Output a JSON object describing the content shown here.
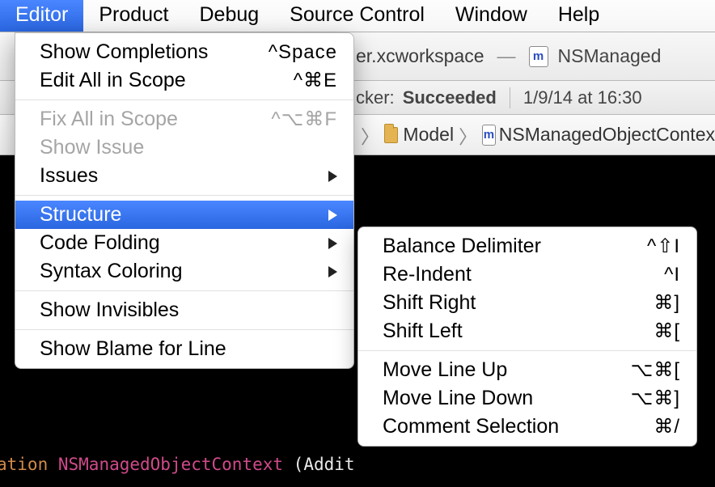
{
  "menubar": {
    "items": [
      "Editor",
      "Product",
      "Debug",
      "Source Control",
      "Window",
      "Help"
    ],
    "active_index": 0
  },
  "toolbar": {
    "workspace_suffix": "er.xcworkspace",
    "dash": "—",
    "open_file": "NSManaged",
    "status_prefix": "cker:",
    "status_value": "Succeeded",
    "timestamp": "1/9/14 at 16:30"
  },
  "breadcrumb": {
    "folder": "Model",
    "file": "NSManagedObjectContex"
  },
  "editor_menu": {
    "items": [
      {
        "label": "Show Completions",
        "shortcut": "^Space",
        "submenu": false,
        "disabled": false
      },
      {
        "label": "Edit All in Scope",
        "shortcut": "^⌘E",
        "submenu": false,
        "disabled": false
      },
      {
        "sep": true
      },
      {
        "label": "Fix All in Scope",
        "shortcut": "^⌥⌘F",
        "submenu": false,
        "disabled": true
      },
      {
        "label": "Show Issue",
        "shortcut": "",
        "submenu": false,
        "disabled": true
      },
      {
        "label": "Issues",
        "shortcut": "",
        "submenu": true,
        "disabled": false
      },
      {
        "sep": true
      },
      {
        "label": "Structure",
        "shortcut": "",
        "submenu": true,
        "disabled": false,
        "highlight": true
      },
      {
        "label": "Code Folding",
        "shortcut": "",
        "submenu": true,
        "disabled": false
      },
      {
        "label": "Syntax Coloring",
        "shortcut": "",
        "submenu": true,
        "disabled": false
      },
      {
        "sep": true
      },
      {
        "label": "Show Invisibles",
        "shortcut": "",
        "submenu": false,
        "disabled": false
      },
      {
        "sep": true
      },
      {
        "label": "Show Blame for Line",
        "shortcut": "",
        "submenu": false,
        "disabled": false
      }
    ]
  },
  "structure_menu": {
    "items": [
      {
        "label": "Balance Delimiter",
        "shortcut": "^⇧I"
      },
      {
        "label": "Re-Indent",
        "shortcut": "^I"
      },
      {
        "label": "Shift Right",
        "shortcut": "⌘]"
      },
      {
        "label": "Shift Left",
        "shortcut": "⌘["
      },
      {
        "sep": true
      },
      {
        "label": "Move Line Up",
        "shortcut": "⌥⌘["
      },
      {
        "label": "Move Line Down",
        "shortcut": "⌥⌘]"
      },
      {
        "label": "Comment Selection",
        "shortcut": "⌘/"
      }
    ]
  },
  "code": {
    "kw": "ation",
    "type": "NSManagedObjectContext",
    "rest": " (Addit"
  }
}
